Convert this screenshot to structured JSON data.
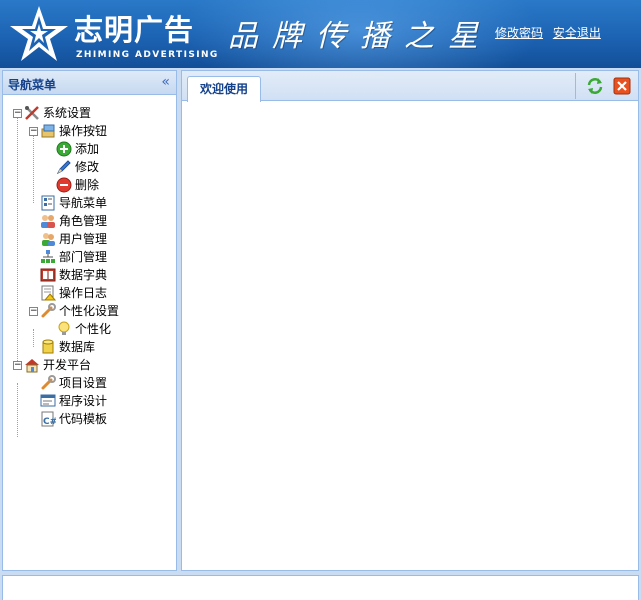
{
  "header": {
    "logo_cn": "志明广告",
    "logo_en": "ZHIMING ADVERTISING",
    "slogan": "品牌传播之星",
    "links": [
      "修改密码",
      "安全退出"
    ]
  },
  "nav": {
    "title": "导航菜单",
    "collapse_glyph": "«",
    "tree": [
      {
        "label": "系统设置",
        "icon": "tools-icon"
      },
      {
        "label": "操作按钮",
        "icon": "buttons-icon"
      },
      {
        "label": "添加",
        "icon": "add-icon"
      },
      {
        "label": "修改",
        "icon": "pencil-icon"
      },
      {
        "label": "删除",
        "icon": "delete-icon"
      },
      {
        "label": "导航菜单",
        "icon": "menu-icon"
      },
      {
        "label": "角色管理",
        "icon": "role-icon"
      },
      {
        "label": "用户管理",
        "icon": "user-icon"
      },
      {
        "label": "部门管理",
        "icon": "org-icon"
      },
      {
        "label": "数据字典",
        "icon": "dictionary-icon"
      },
      {
        "label": "操作日志",
        "icon": "log-icon"
      },
      {
        "label": "个性化设置",
        "icon": "wrench-icon"
      },
      {
        "label": "个性化",
        "icon": "bulb-icon"
      },
      {
        "label": "数据库",
        "icon": "database-icon"
      },
      {
        "label": "开发平台",
        "icon": "home-icon"
      },
      {
        "label": "项目设置",
        "icon": "wrench-icon"
      },
      {
        "label": "程序设计",
        "icon": "design-icon"
      },
      {
        "label": "代码模板",
        "icon": "code-icon"
      }
    ]
  },
  "main": {
    "tabs": [
      {
        "label": "欢迎使用"
      }
    ],
    "tools": [
      "refresh-icon",
      "close-icon"
    ]
  },
  "colors": {
    "header_blue": "#1c63b3",
    "panel_border": "#99bbe8",
    "title_text": "#15428b"
  }
}
